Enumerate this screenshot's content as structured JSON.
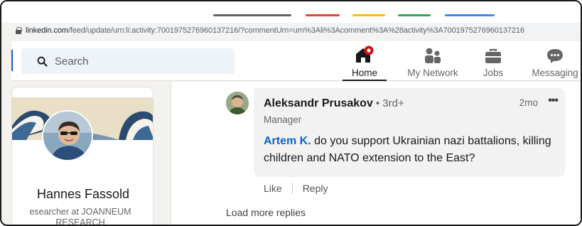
{
  "browser": {
    "tab_colors": [
      "#5f6368",
      "#ea4335",
      "#fbbc04",
      "#34a853",
      "#4285f4"
    ],
    "url_host": "linkedin.com",
    "url_path": "/feed/update/urn:li:activity:7001975276960137216/?commentUrn=urn%3Ali%3Acomment%3A%28activity%3A7001975276960137216"
  },
  "header": {
    "search_placeholder": "Search",
    "nav": [
      {
        "label": "Home",
        "icon": "home-icon",
        "active": true
      },
      {
        "label": "My Network",
        "icon": "my-network-icon"
      },
      {
        "label": "Jobs",
        "icon": "briefcase-icon"
      },
      {
        "label": "Messaging",
        "icon": "messaging-icon"
      }
    ]
  },
  "profile": {
    "name": "Hannes Fassold",
    "subtitle_line1": "esearcher at JOANNEUM",
    "subtitle_line2": "RESEARCH"
  },
  "comment": {
    "author": "Aleksandr Prusakov",
    "degree": "• 3rd+",
    "title": "Manager",
    "time": "2mo",
    "more": "•••",
    "mention": "Artem K.",
    "text": " do you support Ukrainian nazi battalions, killing children and NATO extension to the East?",
    "like": "Like",
    "reply": "Reply"
  },
  "load_more": "Load more replies",
  "colors": {
    "brand": "#0a66c2",
    "notification": "#cc1016"
  }
}
